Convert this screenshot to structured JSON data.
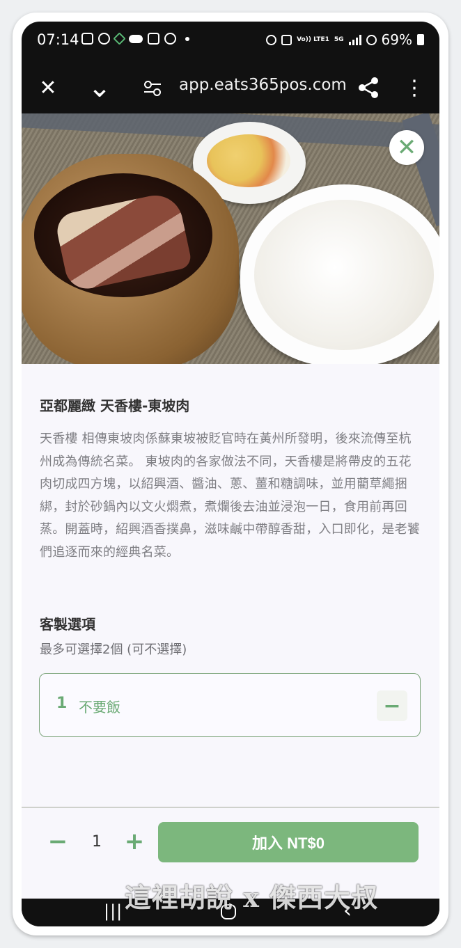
{
  "status_bar": {
    "time": "07:14",
    "battery": "69%",
    "left_icons": [
      "calendar-icon",
      "threads-icon",
      "leaf-icon",
      "cloud-icon",
      "instagram-icon",
      "go-icon"
    ],
    "right_icons": [
      "alarm-icon",
      "mute-icon",
      "volte-icon",
      "5g-icon",
      "signal-icon",
      "block-icon",
      "battery-icon"
    ],
    "volte_label": "Vo)) LTE1",
    "net_label": "5G"
  },
  "browser": {
    "url": "app.eats365pos.com",
    "close_glyph": "✕",
    "collapse_glyph": "⌄",
    "share_glyph": "⋖",
    "menu_glyph": "⋮"
  },
  "item": {
    "close_glyph": "✕",
    "title": "亞都麗緻 天香樓-東坡肉",
    "description": "天香樓 相傳東坡肉係蘇東坡被貶官時在黃州所發明，後來流傳至杭州成為傳統名菜。 東坡肉的各家做法不同，天香樓是將帶皮的五花肉切成四方塊，以紹興酒、醬油、蔥、薑和糖調味，並用藺草繩捆綁，封於砂鍋內以文火燜煮，煮爛後去油並浸泡一日，食用前再回蒸。開蓋時，紹興酒香撲鼻，滋味鹹中帶醇香甜，入口即化，是老饕們追逐而來的經典名菜。"
  },
  "options": {
    "title": "客製選項",
    "subtitle": "最多可選擇2個 (可不選擇)",
    "items": [
      {
        "quantity": "1",
        "label": "不要飯",
        "minus_glyph": "−"
      }
    ]
  },
  "cart": {
    "minus_glyph": "−",
    "quantity": "1",
    "plus_glyph": "+",
    "add_label": "加入 NT$0",
    "accent_color": "#7cb77d"
  },
  "nav": {
    "recent_glyph": "|||",
    "back_glyph": "‹"
  },
  "watermark": "這裡胡說 x 傑西大叔"
}
